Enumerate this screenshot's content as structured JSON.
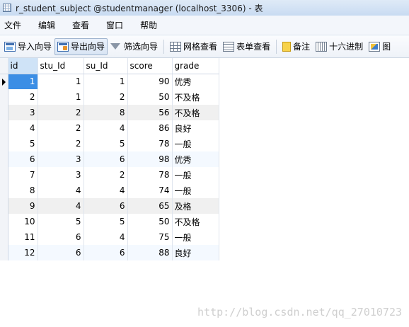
{
  "window": {
    "title": "r_student_subject @studentmanager (localhost_3306) - 表"
  },
  "menu": {
    "items": [
      "文件",
      "编辑",
      "查看",
      "窗口",
      "帮助"
    ]
  },
  "toolbar": {
    "import_label": "导入向导",
    "export_label": "导出向导",
    "filter_label": "筛选向导",
    "grid_view_label": "网格查看",
    "form_view_label": "表单查看",
    "memo_label": "备注",
    "hex_label": "十六进制",
    "image_label": "图"
  },
  "grid": {
    "columns": [
      "id",
      "stu_Id",
      "su_Id",
      "score",
      "grade"
    ],
    "rows": [
      [
        "1",
        "1",
        "1",
        "90",
        "优秀"
      ],
      [
        "2",
        "1",
        "2",
        "50",
        "不及格"
      ],
      [
        "3",
        "2",
        "8",
        "56",
        "不及格"
      ],
      [
        "4",
        "2",
        "4",
        "86",
        "良好"
      ],
      [
        "5",
        "2",
        "5",
        "78",
        "一般"
      ],
      [
        "6",
        "3",
        "6",
        "98",
        "优秀"
      ],
      [
        "7",
        "3",
        "2",
        "78",
        "一般"
      ],
      [
        "8",
        "4",
        "4",
        "74",
        "一般"
      ],
      [
        "9",
        "4",
        "6",
        "65",
        "及格"
      ],
      [
        "10",
        "5",
        "5",
        "50",
        "不及格"
      ],
      [
        "11",
        "6",
        "4",
        "75",
        "一般"
      ],
      [
        "12",
        "6",
        "6",
        "88",
        "良好"
      ]
    ]
  },
  "watermark": "http://blog.csdn.net/qq_27010723",
  "colors": {
    "selection": "#3b8ee5",
    "header_highlight": "#cfe3f7"
  }
}
